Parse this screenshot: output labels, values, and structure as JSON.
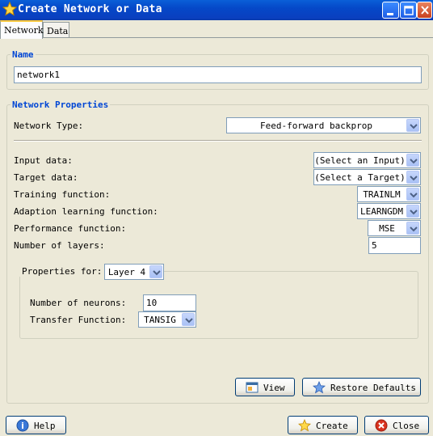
{
  "window": {
    "title": "Create Network or Data",
    "icon": "star-icon"
  },
  "tabs": [
    {
      "label": "Network",
      "active": true
    },
    {
      "label": "Data",
      "active": false
    }
  ],
  "name_group": {
    "legend": "Name",
    "value": "network1"
  },
  "props_group": {
    "legend": "Network Properties",
    "network_type_label": "Network Type:",
    "network_type_value": "Feed-forward backprop",
    "input_data_label": "Input data:",
    "input_data_value": "(Select an Input)",
    "target_data_label": "Target data:",
    "target_data_value": "(Select a Target)",
    "training_fn_label": "Training function:",
    "training_fn_value": "TRAINLM",
    "adaption_fn_label": "Adaption learning function:",
    "adaption_fn_value": "LEARNGDM",
    "performance_fn_label": "Performance function:",
    "performance_fn_value": "MSE",
    "num_layers_label": "Number of layers:",
    "num_layers_value": "5"
  },
  "layer_group": {
    "properties_for_label": "Properties for:",
    "layer_value": "Layer 4",
    "neurons_label": "Number of neurons:",
    "neurons_value": "10",
    "transfer_fn_label": "Transfer Function:",
    "transfer_fn_value": "TANSIG"
  },
  "buttons": {
    "view": "View",
    "restore_defaults": "Restore Defaults",
    "help": "Help",
    "create": "Create",
    "close": "Close"
  }
}
